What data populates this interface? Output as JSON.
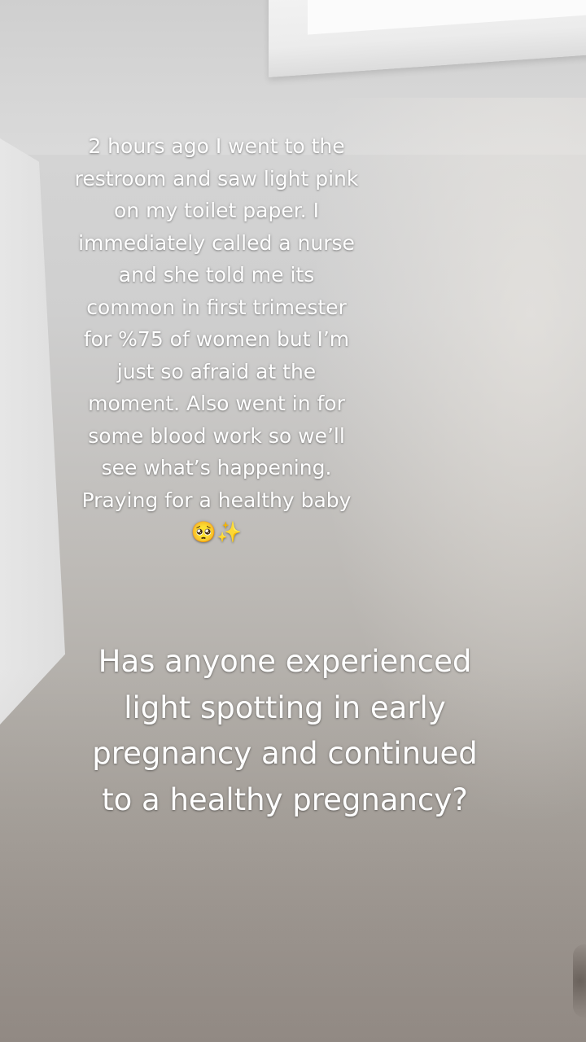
{
  "top_caption": {
    "text": "2 hours ago I went to the\nrestroom and saw light pink\non my toilet paper. I\nimmediately called a nurse\nand she told me its\ncommon in first trimester\nfor %75 of women but I’m\njust so afraid at the\nmoment. Also went in for\nsome blood work so we’ll\nsee what’s happening.\nPraying for a healthy baby\n🥺✨"
  },
  "bottom_caption": {
    "text": "Has anyone experienced\nlight spotting in early\npregnancy and continued\nto a healthy pregnancy?"
  }
}
